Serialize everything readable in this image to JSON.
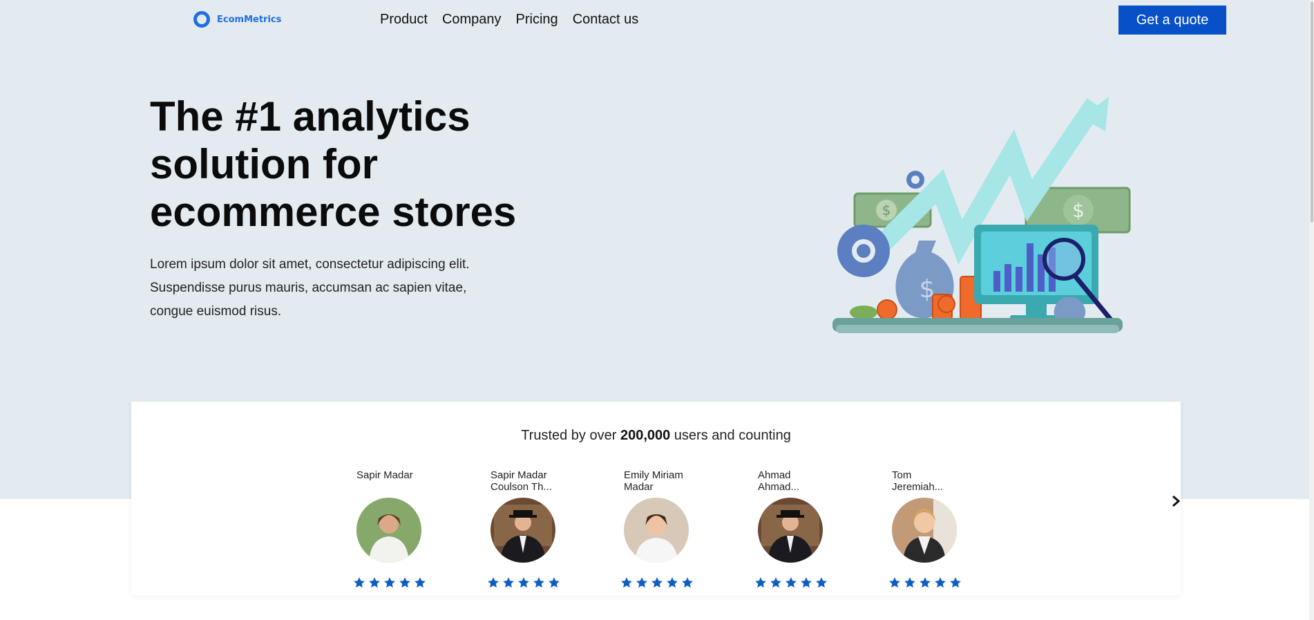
{
  "brand": {
    "name": "EcomMetrics",
    "accent": "#1f6fe0"
  },
  "nav": {
    "links": [
      "Product",
      "Company",
      "Pricing",
      "Contact us"
    ],
    "cta_label": "Get a quote",
    "cta_color": "#0750c7"
  },
  "hero": {
    "title_lines": [
      "The #1 analytics",
      "solution for",
      "ecommerce stores"
    ],
    "subtitle": "Lorem ipsum dolor sit amet, consectetur adipiscing elit. Suspendisse purus mauris, accumsan ac sapien vitae, congue euismod risus.",
    "illustration_icon": "analytics-growth-illustration"
  },
  "trust": {
    "prefix": "Trusted by over ",
    "count": "200,000",
    "suffix": " users and counting",
    "reviewers": [
      {
        "name": "Sapir Madar",
        "rating": 5
      },
      {
        "name": "Sapir Madar Coulson Th...",
        "rating": 5
      },
      {
        "name": "Emily Miriam Madar",
        "rating": 5
      },
      {
        "name": "Ahmad Ahmad...",
        "rating": 5
      },
      {
        "name": "Tom Jeremiah...",
        "rating": 5
      }
    ],
    "star_color": "#0c5dc4",
    "next_icon": "chevron-right-icon"
  }
}
